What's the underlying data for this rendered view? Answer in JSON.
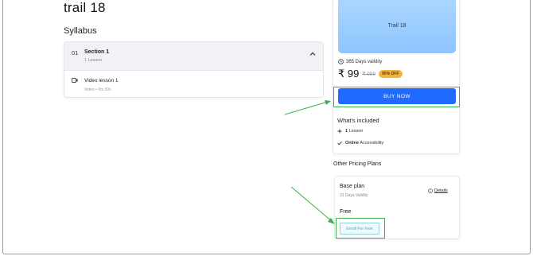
{
  "course": {
    "title": "trail 18"
  },
  "syllabus": {
    "heading": "Syllabus",
    "sections": [
      {
        "number": "01",
        "title": "Section 1",
        "subtitle": "1 Lesson",
        "lessons": [
          {
            "title": "Video lesson 1",
            "meta": "Video • 0m 30s"
          }
        ]
      }
    ]
  },
  "purchase": {
    "thumbnail_title": "Trail 18",
    "validity": "365 Days validity",
    "price": "₹ 99",
    "mrp": "₹ 999",
    "discount_badge": "90% OFF",
    "buy_label": "BUY NOW",
    "included": {
      "title": "What's included",
      "items": [
        {
          "icon": "plus-icon",
          "bold": "1",
          "text": "Lesson"
        },
        {
          "icon": "check-icon",
          "bold": "Online",
          "text": "Accessibility"
        }
      ]
    }
  },
  "other_plans": {
    "heading": "Other Pricing Plans",
    "plans": [
      {
        "name": "Base plan",
        "validity": "31 Days Validity",
        "details_label": "Details",
        "price": "Free",
        "enroll_label": "Enroll For Free"
      }
    ]
  },
  "colors": {
    "accent": "#1f6bff",
    "highlight": "#3ab34a",
    "badge": "#f5b23e",
    "thumbnail": "#a9d6ff"
  }
}
